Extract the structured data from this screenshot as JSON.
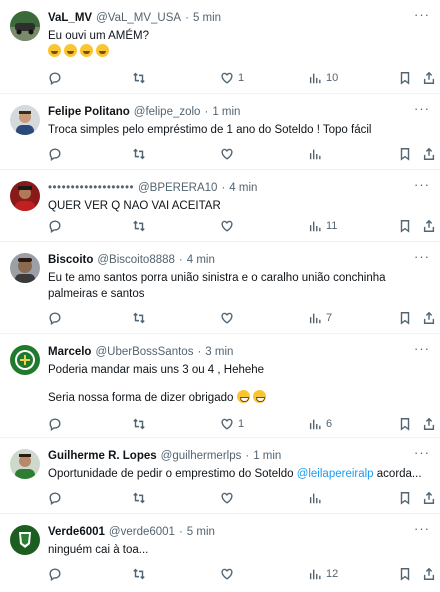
{
  "tweets": [
    {
      "name": "VaL_MV",
      "handle": "@VaL_MV_USA",
      "time": "5 min",
      "lines": [
        "Eu ouvi um AMÉM?"
      ],
      "emoji_count": 4,
      "stats": {
        "reply": "",
        "retweet": "",
        "like": "1",
        "views": "10"
      }
    },
    {
      "name": "Felipe Politano",
      "handle": "@felipe_zolo",
      "time": "1 min",
      "lines": [
        "Troca simples pelo empréstimo de 1 ano do Soteldo ! Topo fácil"
      ],
      "stats": {
        "reply": "",
        "retweet": "",
        "like": "",
        "views": ""
      }
    },
    {
      "name": "•••••••••••••••••••",
      "handle": "@BPERERA10",
      "time": "4 min",
      "lines": [
        "QUER VER Q NAO VAI ACEITAR"
      ],
      "stats": {
        "reply": "",
        "retweet": "",
        "like": "",
        "views": "11"
      }
    },
    {
      "name": "Biscoito",
      "handle": "@Biscoito8888",
      "time": "4 min",
      "lines": [
        "Eu te amo santos porra união sinistra e o caralho união conchinha",
        "palmeiras e santos"
      ],
      "stats": {
        "reply": "",
        "retweet": "",
        "like": "",
        "views": "7"
      }
    },
    {
      "name": "Marcelo",
      "handle": "@UberBossSantos",
      "time": "3 min",
      "lines": [
        "Poderia mandar mais uns 3 ou 4 , Hehehe",
        "",
        "Seria nossa forma de dizer obrigado"
      ],
      "stats": {
        "reply": "",
        "retweet": "",
        "like": "1",
        "views": "6"
      }
    },
    {
      "name": "Guilherme R. Lopes",
      "handle": "@guilhermerlps",
      "time": "1 min",
      "line_before": "Oportunidade de pedir o emprestimo do Soteldo ",
      "mention": "@leilapereiralp",
      "line_after": " acorda...",
      "stats": {
        "reply": "",
        "retweet": "",
        "like": "",
        "views": ""
      }
    },
    {
      "name": "Verde6001",
      "handle": "@verde6001",
      "time": "5 min",
      "lines": [
        "ninguém cai à toa..."
      ],
      "stats": {
        "reply": "",
        "retweet": "",
        "like": "",
        "views": "12"
      }
    }
  ],
  "dot": "·",
  "more_glyph": "···",
  "colors": {
    "text": "#0f1419",
    "muted": "#536471",
    "link": "#1d9bf0",
    "divider": "#eff3f4"
  }
}
